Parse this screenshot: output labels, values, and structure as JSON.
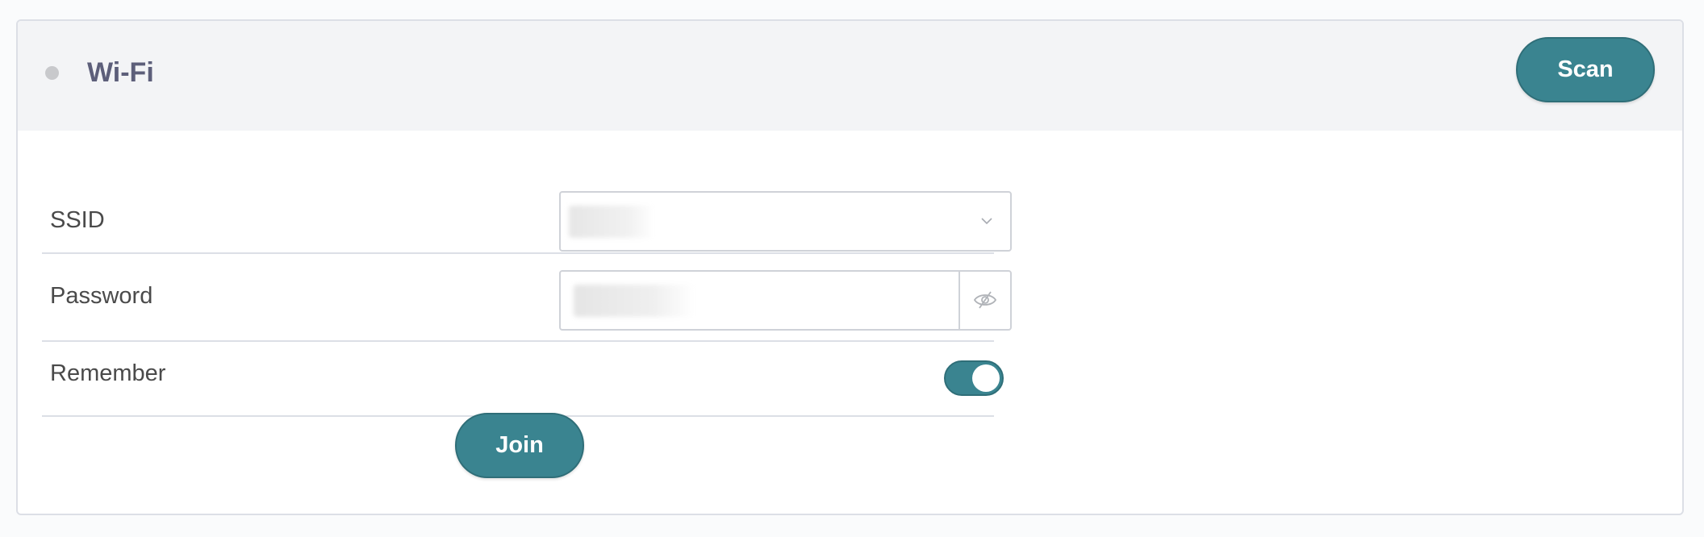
{
  "card": {
    "title": "Wi-Fi",
    "status": "inactive",
    "scan_label": "Scan"
  },
  "form": {
    "ssid": {
      "label": "SSID",
      "value": "",
      "icon": "chevron-down-icon"
    },
    "password": {
      "label": "Password",
      "value": "",
      "icon": "eye-off-icon"
    },
    "remember": {
      "label": "Remember",
      "checked": true
    },
    "join_label": "Join"
  },
  "colors": {
    "accent": "#3a8490",
    "header_bg": "#f3f4f6",
    "border": "#dcdfe6",
    "status_dot": "#c8c9cc",
    "title": "#5d5f7a"
  }
}
